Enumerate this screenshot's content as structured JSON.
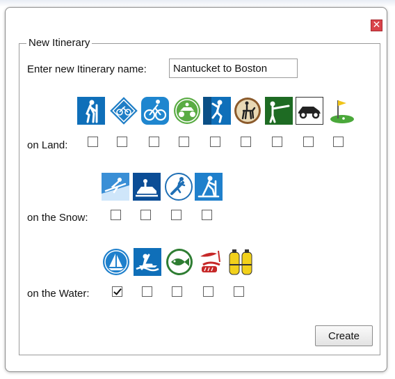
{
  "dialog": {
    "legend": "New Itinerary",
    "name_label": "Enter new Itinerary name:",
    "name_value": "Nantucket to Boston",
    "close_glyph": "✕",
    "create_label": "Create"
  },
  "sections": {
    "land": {
      "label": "on Land:",
      "icons": [
        "hiking-icon",
        "cycling-icon",
        "mountain-biking-icon",
        "atv-icon",
        "climbing-icon",
        "horseback-riding-icon",
        "hunting-icon",
        "off-road-vehicle-icon",
        "golf-icon"
      ],
      "checked": [
        false,
        false,
        false,
        false,
        false,
        false,
        false,
        false,
        false
      ]
    },
    "snow": {
      "label": "on the Snow:",
      "icons": [
        "skiing-icon",
        "snowmobile-icon",
        "snowboarding-icon",
        "cross-country-skiing-icon"
      ],
      "checked": [
        false,
        false,
        false,
        false
      ]
    },
    "water": {
      "label": "on the Water:",
      "icons": [
        "sailing-icon",
        "rafting-icon",
        "fishing-icon",
        "surfing-icon",
        "scuba-diving-icon"
      ],
      "checked": [
        true,
        false,
        false,
        false,
        false
      ]
    }
  },
  "colors": {
    "icon_blue": "#0f6fb9",
    "icon_green": "#2e7d2e",
    "close_red": "#d9434a"
  }
}
